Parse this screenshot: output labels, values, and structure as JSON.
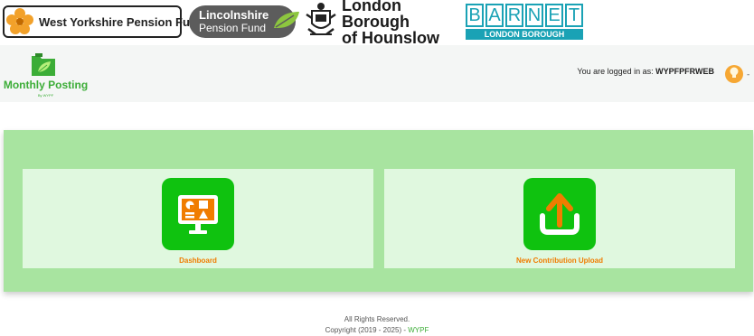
{
  "logos": {
    "wypf": "West Yorkshire Pension Fund",
    "lincs_line1": "Lincolnshire",
    "lincs_line2": "Pension Fund",
    "hounslow_line1": "London Borough",
    "hounslow_line2": "of Hounslow",
    "barnet_letters": [
      "B",
      "A",
      "R",
      "N",
      "E",
      "T"
    ],
    "barnet_sub": "LONDON BOROUGH"
  },
  "header": {
    "app_title": "Monthly Posting",
    "app_subtitle": "By WYPF",
    "login_prefix": "You are logged in as:",
    "username": "WYPFPFRWEB",
    "trailing": "-"
  },
  "cards": [
    {
      "label": "Dashboard",
      "icon": "dashboard-monitor-icon"
    },
    {
      "label": "New Contribution Upload",
      "icon": "upload-icon"
    }
  ],
  "footer": {
    "line1": "All Rights Reserved.",
    "copyright": "Copyright (2019 - 2025) -",
    "link": "WYPF"
  },
  "colors": {
    "brand_green": "#3cad37",
    "tile_green": "#0fc20f",
    "panel_green": "#a8e4a0",
    "card_bg": "#e0f8df",
    "label_orange": "#f07c00",
    "barnet_teal": "#1aa2b5"
  }
}
